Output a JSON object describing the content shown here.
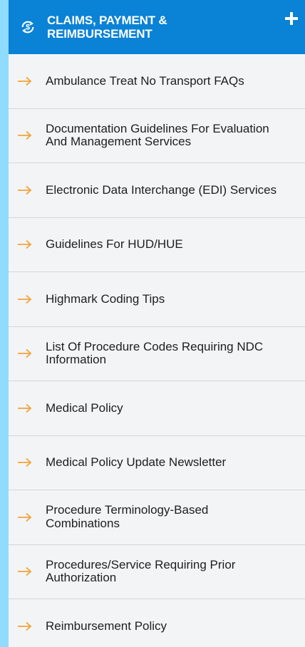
{
  "header": {
    "title": "CLAIMS, PAYMENT & REIMBURSEMENT",
    "icon": "dollar-refresh-icon",
    "expand_icon": "plus-icon"
  },
  "colors": {
    "outer_background": "#8fdcff",
    "header_background": "#0a82d6",
    "panel_background": "#f3f4f6",
    "arrow": "#f2a33a",
    "text": "#1e1e1e",
    "divider": "#d6d6d6"
  },
  "items": [
    {
      "label": "Ambulance Treat No Transport FAQs"
    },
    {
      "label": "Documentation Guidelines For Evaluation And Management Services"
    },
    {
      "label": "Electronic Data Interchange (EDI) Services"
    },
    {
      "label": "Guidelines For HUD/HUE"
    },
    {
      "label": "Highmark Coding Tips"
    },
    {
      "label": "List Of Procedure Codes Requiring NDC Information"
    },
    {
      "label": "Medical Policy"
    },
    {
      "label": "Medical Policy Update Newsletter"
    },
    {
      "label": "Procedure Terminology-Based Combinations"
    },
    {
      "label": "Procedures/Service Requiring Prior Authorization"
    },
    {
      "label": "Reimbursement Policy"
    }
  ]
}
